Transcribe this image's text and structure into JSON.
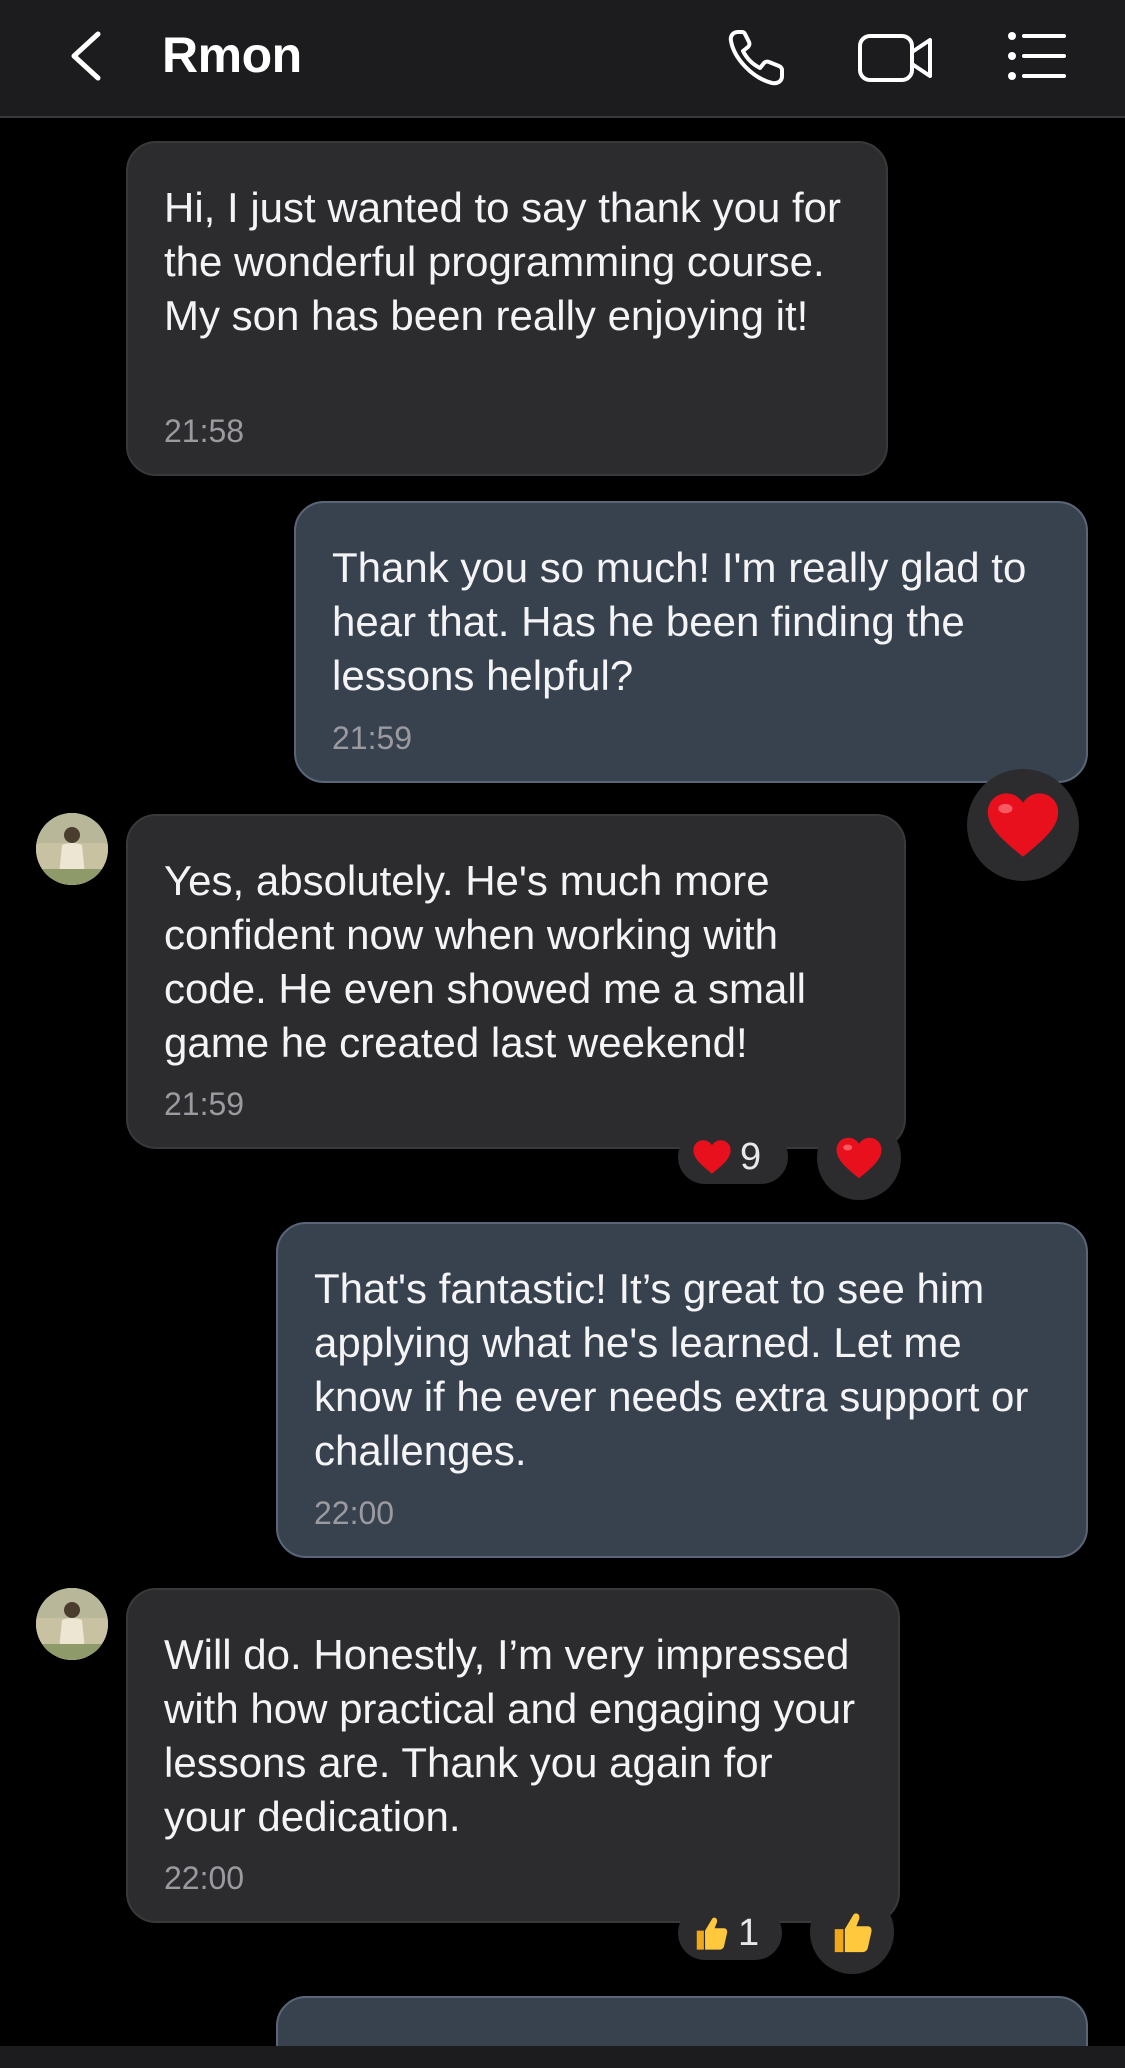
{
  "header": {
    "title": "Rmon"
  },
  "messages": [
    {
      "text": "Hi, I just wanted to say thank you for the wonderful programming course. My son has been really enjoying it!",
      "time": "21:58"
    },
    {
      "text": "Thank you so much! I'm really glad to hear that. Has he been finding the lessons helpful?",
      "time": "21:59"
    },
    {
      "text": "Yes, absolutely. He's much more confident now when working with code. He even showed me a small game he created last weekend!",
      "time": "21:59"
    },
    {
      "text": "That's fantastic! It’s great to see him applying what he's learned. Let me know if he ever needs extra support or challenges.",
      "time": "22:00"
    },
    {
      "text": "Will do. Honestly, I’m very impressed with how practical and engaging your lessons are. Thank you again for your dedication.",
      "time": "22:00"
    }
  ],
  "reactions": {
    "msg3_heart_count": "9",
    "msg5_thumbs_count": "1"
  }
}
